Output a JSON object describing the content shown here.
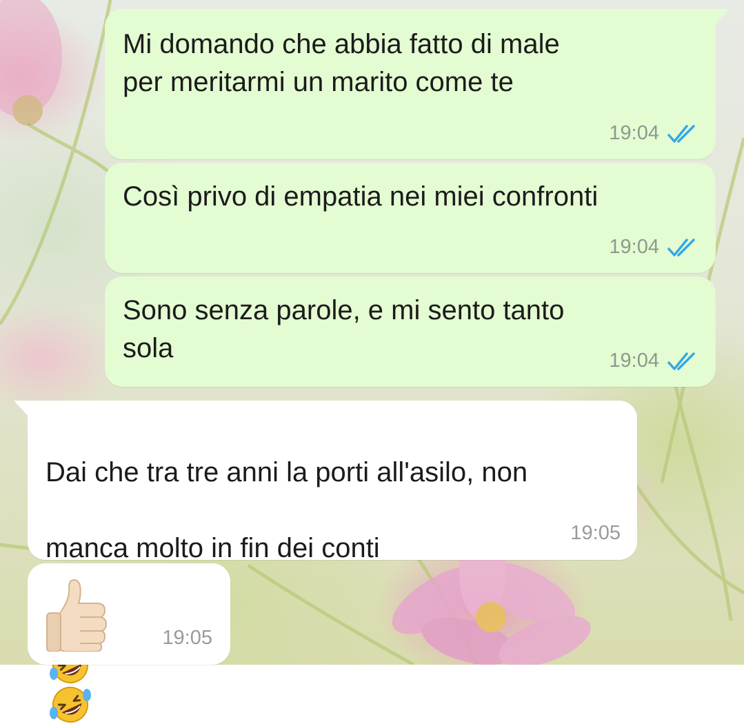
{
  "chat": {
    "messages": [
      {
        "direction": "outgoing",
        "text": "Mi domando che abbia fatto di male\nper meritarmi un marito come te",
        "time": "19:04",
        "status": "read"
      },
      {
        "direction": "outgoing",
        "text": "Così privo di empatia nei miei confronti",
        "time": "19:04",
        "status": "read"
      },
      {
        "direction": "outgoing",
        "text": "Sono senza parole, e mi sento tanto\nsola",
        "time": "19:04",
        "status": "read"
      },
      {
        "direction": "incoming",
        "text_line1": "Dai che tra tre anni la porti all'asilo, non",
        "text_line2": "manca molto in fin dei conti",
        "emoji": "rolling-on-the-floor-laughing-icon",
        "emoji_count": 3,
        "time": "19:05"
      },
      {
        "direction": "incoming",
        "emoji": "thumbs-up-icon",
        "time": "19:05"
      }
    ]
  },
  "colors": {
    "outgoing_bubble": "#e3fcd2",
    "incoming_bubble": "#ffffff",
    "read_ticks": "#34a8e6",
    "timestamp": "#8b9a8e"
  }
}
